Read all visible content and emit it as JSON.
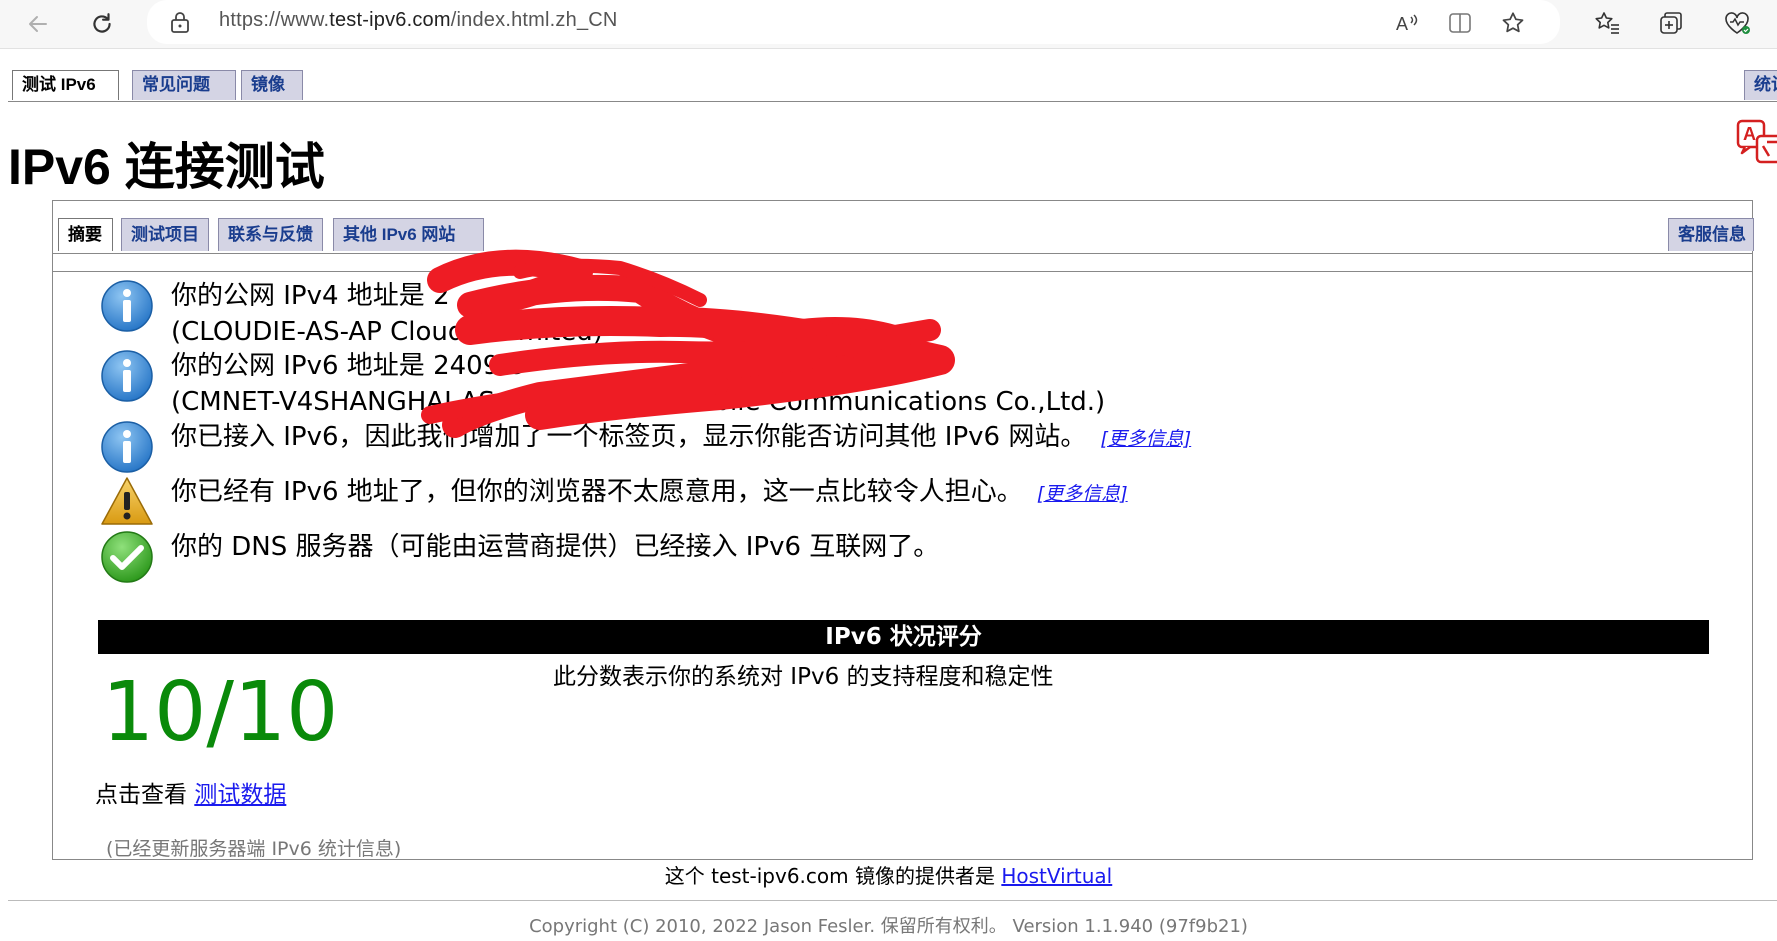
{
  "browser": {
    "url_prefix": "https://www.",
    "url_domain": "test-ipv6.com",
    "url_suffix": "/index.html.zh_CN",
    "icons": [
      "back-icon",
      "refresh-icon",
      "lock-icon",
      "read-aloud-icon",
      "split-screen-icon",
      "favorite-star-icon",
      "favorites-icon",
      "collections-icon",
      "browser-essentials-icon"
    ]
  },
  "top_tabs": [
    {
      "label": "测试 IPv6",
      "active": true
    },
    {
      "label": "常见问题",
      "active": false
    },
    {
      "label": "镜像",
      "active": false
    }
  ],
  "top_tab_right": "统计",
  "page": {
    "title": "IPv6 连接测试"
  },
  "inner_tabs": [
    {
      "label": "摘要",
      "active": true
    },
    {
      "label": "测试项目",
      "active": false
    },
    {
      "label": "联系与反馈",
      "active": false
    },
    {
      "label": "其他 IPv6 网站",
      "active": false
    }
  ],
  "inner_tab_right": "客服信息",
  "messages": [
    {
      "icon": "info-icon",
      "line1": "你的公网 IPv4 地址是 2",
      "line2": "(CLOUDIE-AS-AP Cloudie Limited)"
    },
    {
      "icon": "info-icon",
      "line1": "你的公网 IPv6 地址是 2409:8",
      "line2": "(CMNET-V4SHANGHAI-AS-AP Shanghai Mobile Communications Co.,Ltd.)"
    },
    {
      "icon": "info-icon",
      "line1": "你已接入 IPv6，因此我们增加了一个标签页，显示你能否访问其他 IPv6 网站。",
      "more": "[更多信息]"
    },
    {
      "icon": "warning-icon",
      "line1": "你已经有 IPv6 地址了，但你的浏览器不太愿意用，这一点比较令人担心。",
      "more": "[更多信息]"
    },
    {
      "icon": "check-icon",
      "line1": "你的 DNS 服务器（可能由运营商提供）已经接入 IPv6 互联网了。"
    }
  ],
  "score": {
    "header": "IPv6 状况评分",
    "value": "10/10",
    "description": "此分数表示你的系统对 IPv6 的支持程度和稳定性"
  },
  "view_data": {
    "prefix": "点击查看",
    "link": "测试数据"
  },
  "stats_updated": "(已经更新服务器端 IPv6 统计信息)",
  "footer": {
    "mirror_prefix": "这个 test-ipv6.com 镜像的提供者是",
    "mirror_link": "HostVirtual",
    "copyright": "Copyright (C) 2010, 2022 Jason Fesler. 保留所有权利。 Version 1.1.940 (97f9b21)"
  },
  "colors": {
    "score_green": "#0a8a0a",
    "tab_bg": "#d4d4e4",
    "tab_text": "#1a3d8e",
    "link_blue": "#1a1aee",
    "redaction_red": "#ee1c24"
  }
}
